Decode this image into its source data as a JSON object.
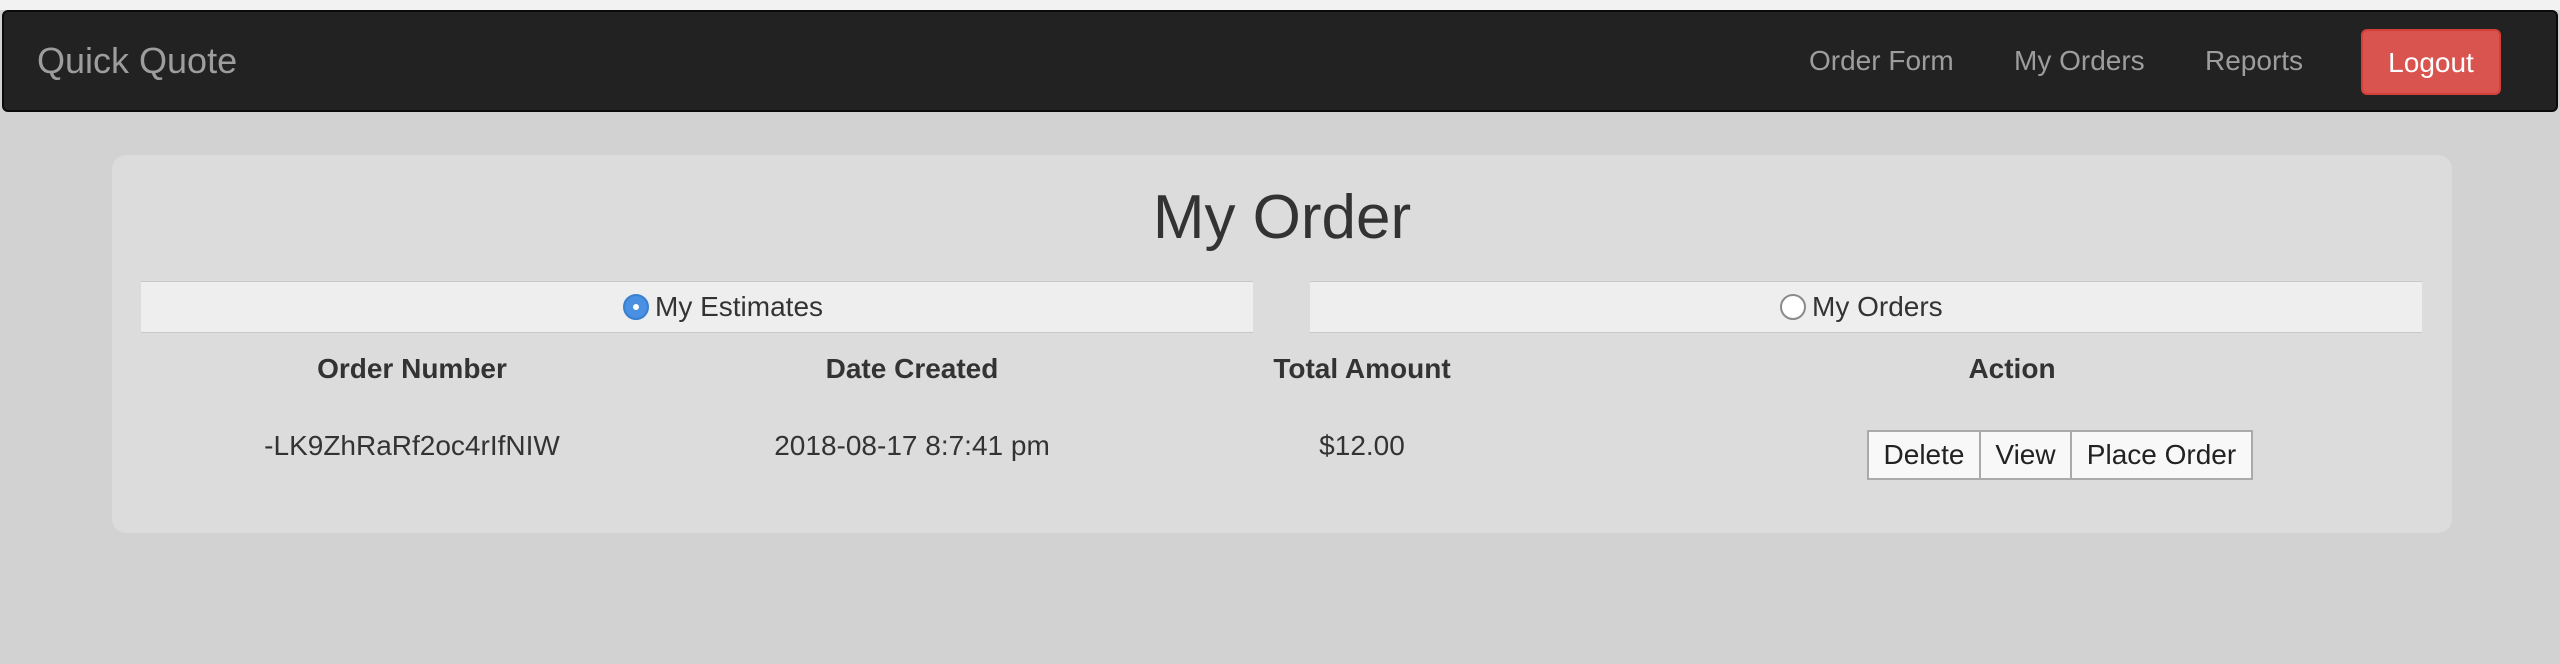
{
  "navbar": {
    "brand": "Quick Quote",
    "links": [
      "Order Form",
      "My Orders",
      "Reports"
    ],
    "logout_label": "Logout",
    "logout_color": "#d9534f"
  },
  "main": {
    "title": "My Order",
    "toggles": [
      {
        "label": "My Estimates",
        "selected": true
      },
      {
        "label": "My Orders",
        "selected": false
      }
    ],
    "table": {
      "headers": [
        "Order Number",
        "Date Created",
        "Total Amount",
        "Action"
      ],
      "rows": [
        {
          "order_number": "-LK9ZhRaRf2oc4rIfNIW",
          "date_created": "2018-08-17 8:7:41 pm",
          "total_amount": "$12.00",
          "actions": [
            "Delete",
            "View",
            "Place Order"
          ]
        }
      ]
    }
  },
  "colors": {
    "accent": "#4a90e2",
    "navbar_bg": "#222222"
  }
}
